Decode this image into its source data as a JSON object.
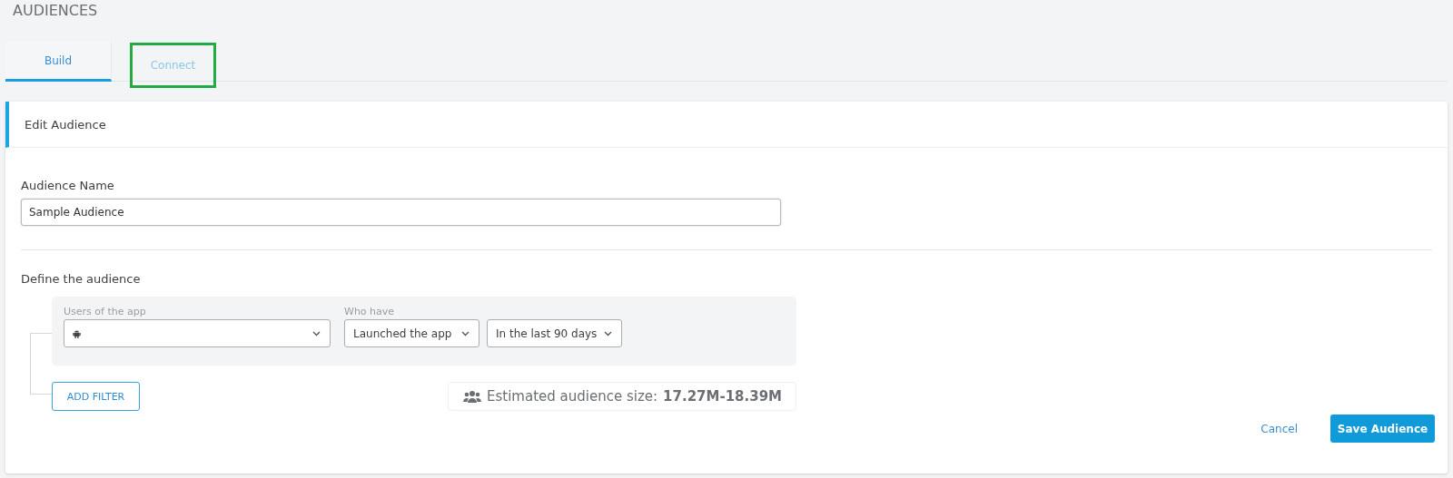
{
  "page_title": "AUDIENCES",
  "tabs": [
    {
      "label": "Build",
      "selected": true,
      "highlighted": false
    },
    {
      "label": "Connect",
      "selected": false,
      "highlighted": true
    }
  ],
  "card": {
    "title": "Edit Audience",
    "name_field": {
      "label": "Audience Name",
      "value": "Sample Audience"
    },
    "define_label": "Define the audience",
    "filter": {
      "app_label": "Users of the app",
      "who_label": "Who have",
      "action": "Launched the app",
      "period": "In the last 90 days"
    },
    "add_filter": "ADD FILTER",
    "estimate": {
      "label": "Estimated audience size:",
      "value": "17.27M-18.39M"
    },
    "cancel": "Cancel",
    "save": "Save Audience"
  }
}
